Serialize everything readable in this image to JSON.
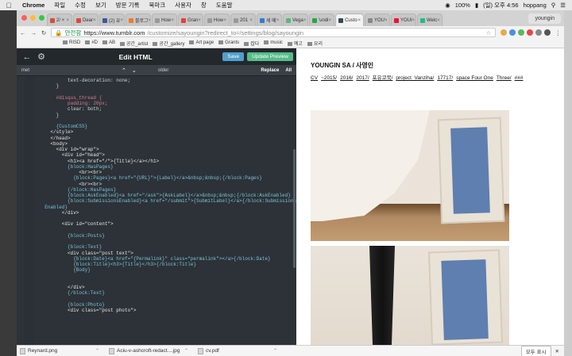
{
  "menubar": {
    "apple": "",
    "items": [
      "Chrome",
      "파일",
      "수정",
      "보기",
      "방문 기록",
      "북마크",
      "사용자",
      "창",
      "도움말"
    ],
    "status": {
      "battery": "100%",
      "clock": "(일) 오후 4:56",
      "user": "hoppang"
    }
  },
  "tabs": [
    {
      "label": "2/ ×",
      "color": "#d94c3d"
    },
    {
      "label": "Dear",
      "color": "#d94c3d"
    },
    {
      "label": "(2) 유",
      "color": "#3b5998"
    },
    {
      "label": "블로그",
      "color": "#ef7b2a"
    },
    {
      "label": "How",
      "color": "#999"
    },
    {
      "label": "Gran",
      "color": "#e0433a"
    },
    {
      "label": "How",
      "color": "#999"
    },
    {
      "label": "201",
      "color": "#999"
    },
    {
      "label": "세 메",
      "color": "#2d7dd2"
    },
    {
      "label": "Vega",
      "color": "#5b7"
    },
    {
      "label": "'undi",
      "color": "#2a4"
    },
    {
      "label": "Custo",
      "color": "#36465d",
      "active": true
    },
    {
      "label": "YOU",
      "color": "#888"
    },
    {
      "label": "YOUI",
      "color": "#e13"
    },
    {
      "label": "Welc",
      "color": "#2b8"
    }
  ],
  "profile_name": "youngin",
  "address": {
    "secure": "안전함",
    "host": "https://www.tumblr.com",
    "path": "/customize/sayoungin?redirect_to=/settings/blog/sayoungin"
  },
  "bookmarks": [
    "RISD",
    "#D",
    "AB",
    "공간_artist",
    "공간_gallery",
    "Art page",
    "Grants",
    "잡다",
    "music",
    "예고",
    "요리"
  ],
  "editor": {
    "title": "Edit HTML",
    "save_label": "Save",
    "update_label": "Update Preview",
    "search_value": "met",
    "replace_value": "older",
    "replace_label": "Replace",
    "all_label": "All",
    "code_lines": [
      {
        "t": "          text-decoration: none;",
        "c": "cm"
      },
      {
        "t": "      }",
        "c": "cm"
      },
      {
        "t": "",
        "c": "cm"
      },
      {
        "t": "      #disqus_thread {",
        "c": "cs"
      },
      {
        "t": "          padding: 20px;",
        "c": "cs"
      },
      {
        "t": "          clear: both;",
        "c": "cm"
      },
      {
        "t": "      }",
        "c": "cm"
      },
      {
        "t": "",
        "c": "cm"
      },
      {
        "t": "      {CustomCSS}",
        "c": "bl"
      },
      {
        "t": "    </style>",
        "c": "tg"
      },
      {
        "t": "    </head>",
        "c": "tg"
      },
      {
        "t": "    <body>",
        "c": "tg"
      },
      {
        "t": "      <div id=\"wrap\">",
        "c": "tg"
      },
      {
        "t": "        <div id=\"head\">",
        "c": "tg"
      },
      {
        "t": "          <h1><a href=\"/\">{Title}</a></h1>",
        "c": "tg"
      },
      {
        "t": "          {block:HasPages}",
        "c": "bl"
      },
      {
        "t": "              <br><br>",
        "c": "tg"
      },
      {
        "t": "            {block:Pages}<a href=\"{URL}\">{Label}</a>&nbsp;&nbsp;{/block:Pages}",
        "c": "bl"
      },
      {
        "t": "              <br><br>",
        "c": "tg"
      },
      {
        "t": "          {/block:HasPages}",
        "c": "bl"
      },
      {
        "t": "          {block:AskEnabled}<a href=\"/ask\">{AskLabel}</a>&nbsp;&nbsp;{/block:AskEnabled}",
        "c": "bl"
      },
      {
        "t": "          {block:SubmissionsEnabled}<a href=\"/submit\">{SubmitLabel}</a>{/block:Submissions",
        "c": "bl"
      },
      {
        "t": "  Enabled}",
        "c": "bl"
      },
      {
        "t": "        </div>",
        "c": "tg"
      },
      {
        "t": "",
        "c": "cm"
      },
      {
        "t": "        <div id=\"content\">",
        "c": "tg"
      },
      {
        "t": "",
        "c": "cm"
      },
      {
        "t": "          {block:Posts}",
        "c": "bl"
      },
      {
        "t": "",
        "c": "cm"
      },
      {
        "t": "          {block:Text}",
        "c": "bl"
      },
      {
        "t": "          <div class=\"post text\">",
        "c": "tg"
      },
      {
        "t": "            {block:Date}<a href=\"{Permalink}\" class=\"permalink\"></a>{/block:Date}",
        "c": "bl"
      },
      {
        "t": "            {block:Title}<h3>{Title}</h3>{/block:Title}",
        "c": "bl"
      },
      {
        "t": "            {Body}",
        "c": "bl"
      },
      {
        "t": "",
        "c": "cm"
      },
      {
        "t": "",
        "c": "cm"
      },
      {
        "t": "          </div>",
        "c": "tg"
      },
      {
        "t": "          {/block:Text}",
        "c": "bl"
      },
      {
        "t": "",
        "c": "cm"
      },
      {
        "t": "          {block:Photo}",
        "c": "bl"
      },
      {
        "t": "          <div class=\"post photo\">",
        "c": "tg"
      }
    ]
  },
  "preview": {
    "site_title": "YOUNGIN SA / 사영인",
    "nav": [
      "CV",
      "~2015/",
      "2016/",
      "2017/",
      "포유코북/",
      "project_Vanziha/",
      "17717/",
      "space Four One",
      "Three/",
      "###"
    ]
  },
  "downloads": {
    "files": [
      "Reynard.png",
      "Aciu-v-ashcroft-redact....jpg",
      "cv.pdf"
    ],
    "show_all": "모두 표시"
  }
}
